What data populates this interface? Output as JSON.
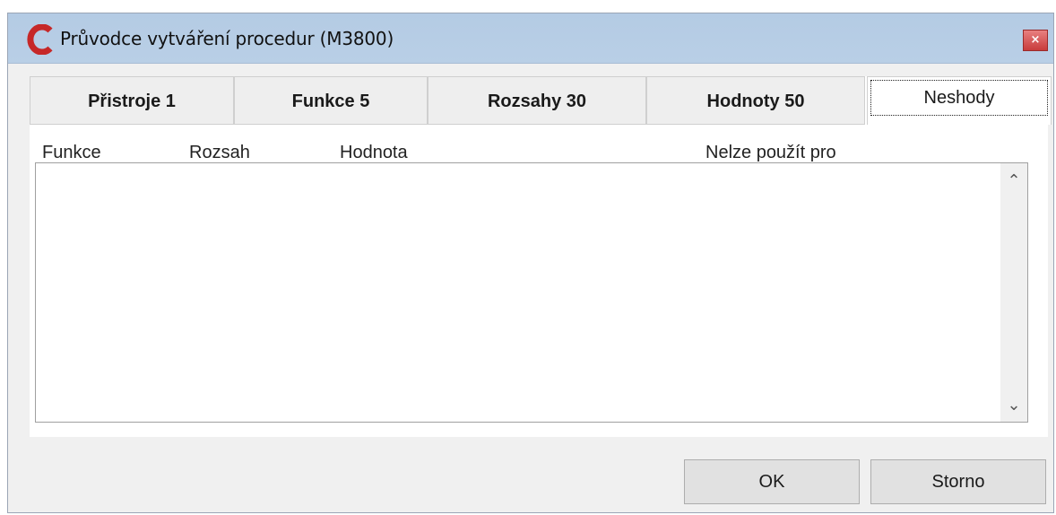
{
  "window": {
    "title": "Průvodce vytváření procedur (M3800)",
    "close_label": "×"
  },
  "tabs": [
    {
      "label": "Přistroje 1"
    },
    {
      "label": "Funkce 5"
    },
    {
      "label": "Rozsahy 30"
    },
    {
      "label": "Hodnoty 50"
    },
    {
      "label": "Neshody",
      "active": true
    }
  ],
  "columns": {
    "funkce": "Funkce",
    "rozsah": "Rozsah",
    "hodnota": "Hodnota",
    "nelze": "Nelze použít pro"
  },
  "scroll": {
    "up": "⌃",
    "down": "⌄"
  },
  "buttons": {
    "ok": "OK",
    "storno": "Storno"
  },
  "colors": {
    "titlebar": "#b4cbe4",
    "close_button": "#d65050",
    "logo": "#c62828"
  }
}
